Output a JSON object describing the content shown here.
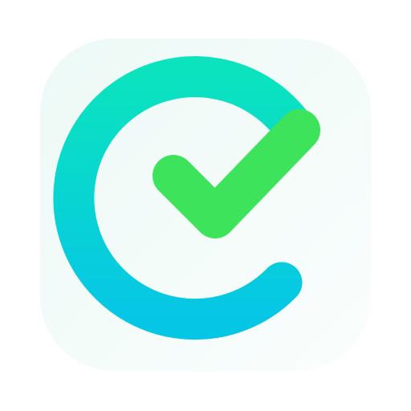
{
  "app_icon": {
    "icon_name": "checkmark-e-logo-icon",
    "colors": {
      "tile_top_left": "#EDF9F6",
      "tile_bottom_right": "#FAFEFD",
      "ring_top": "#0BE3BE",
      "ring_bottom": "#06C6E6",
      "check": "#3DE35A"
    }
  }
}
